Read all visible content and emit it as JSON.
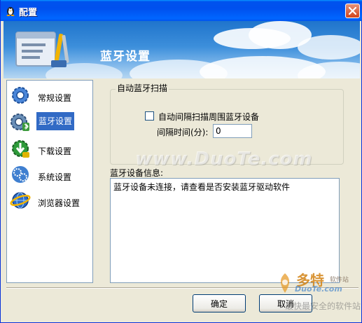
{
  "window": {
    "title": "配置"
  },
  "banner": {
    "title": "蓝牙设置"
  },
  "sidebar": {
    "items": [
      {
        "label": "常规设置",
        "icon": "gear-icon",
        "selected": false
      },
      {
        "label": "蓝牙设置",
        "icon": "bluetooth-gear-icon",
        "selected": true
      },
      {
        "label": "下载设置",
        "icon": "download-icon",
        "selected": false
      },
      {
        "label": "系统设置",
        "icon": "system-gears-icon",
        "selected": false
      },
      {
        "label": "浏览器设置",
        "icon": "globe-icon",
        "selected": false
      }
    ]
  },
  "scan_group": {
    "legend": "自动蓝牙扫描",
    "checkbox_label": "自动间隔扫描周围蓝牙设备",
    "checkbox_checked": false,
    "interval_label": "间隔时间(分):",
    "interval_value": "0"
  },
  "device_info": {
    "label": "蓝牙设备信息:",
    "text": "蓝牙设备未连接，请查看是否安装蓝牙驱动软件"
  },
  "buttons": {
    "ok": "确定",
    "cancel": "取消"
  },
  "watermark": {
    "text": "www.DuoTe.com"
  },
  "logo": {
    "chinese": "多特",
    "small": "软件站",
    "english": "DuoTe.com",
    "slogan": "最快最安全的软件站"
  },
  "colors": {
    "titlebar": "#0053EE",
    "selection": "#316AC5",
    "dialog_bg": "#ECE9D8"
  }
}
